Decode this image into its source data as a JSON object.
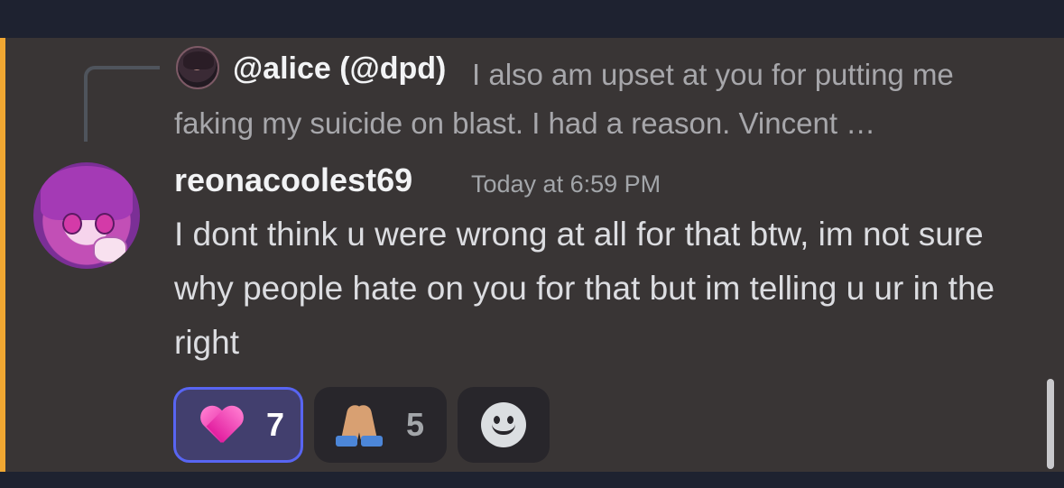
{
  "reply": {
    "author": "@alice (@dpd)",
    "text": "I also am upset at you for putting me faking my suicide on blast. I had a reason. Vincent …"
  },
  "message": {
    "author": "reonacoolest69",
    "timestamp": "Today at 6:59 PM",
    "content": "I dont think u were wrong at all for that btw, im not sure why people hate on you for that but im telling u ur in the right"
  },
  "reactions": [
    {
      "emoji": "heart-emoji",
      "count": "7",
      "active": true
    },
    {
      "emoji": "folded-hands-emoji",
      "count": "5",
      "active": false
    }
  ],
  "add_reaction_icon": "add-reaction-smiley-icon",
  "colors": {
    "mention_strip": "#f0a732",
    "message_bg": "#393535",
    "active_reaction_border": "#5865f2"
  }
}
